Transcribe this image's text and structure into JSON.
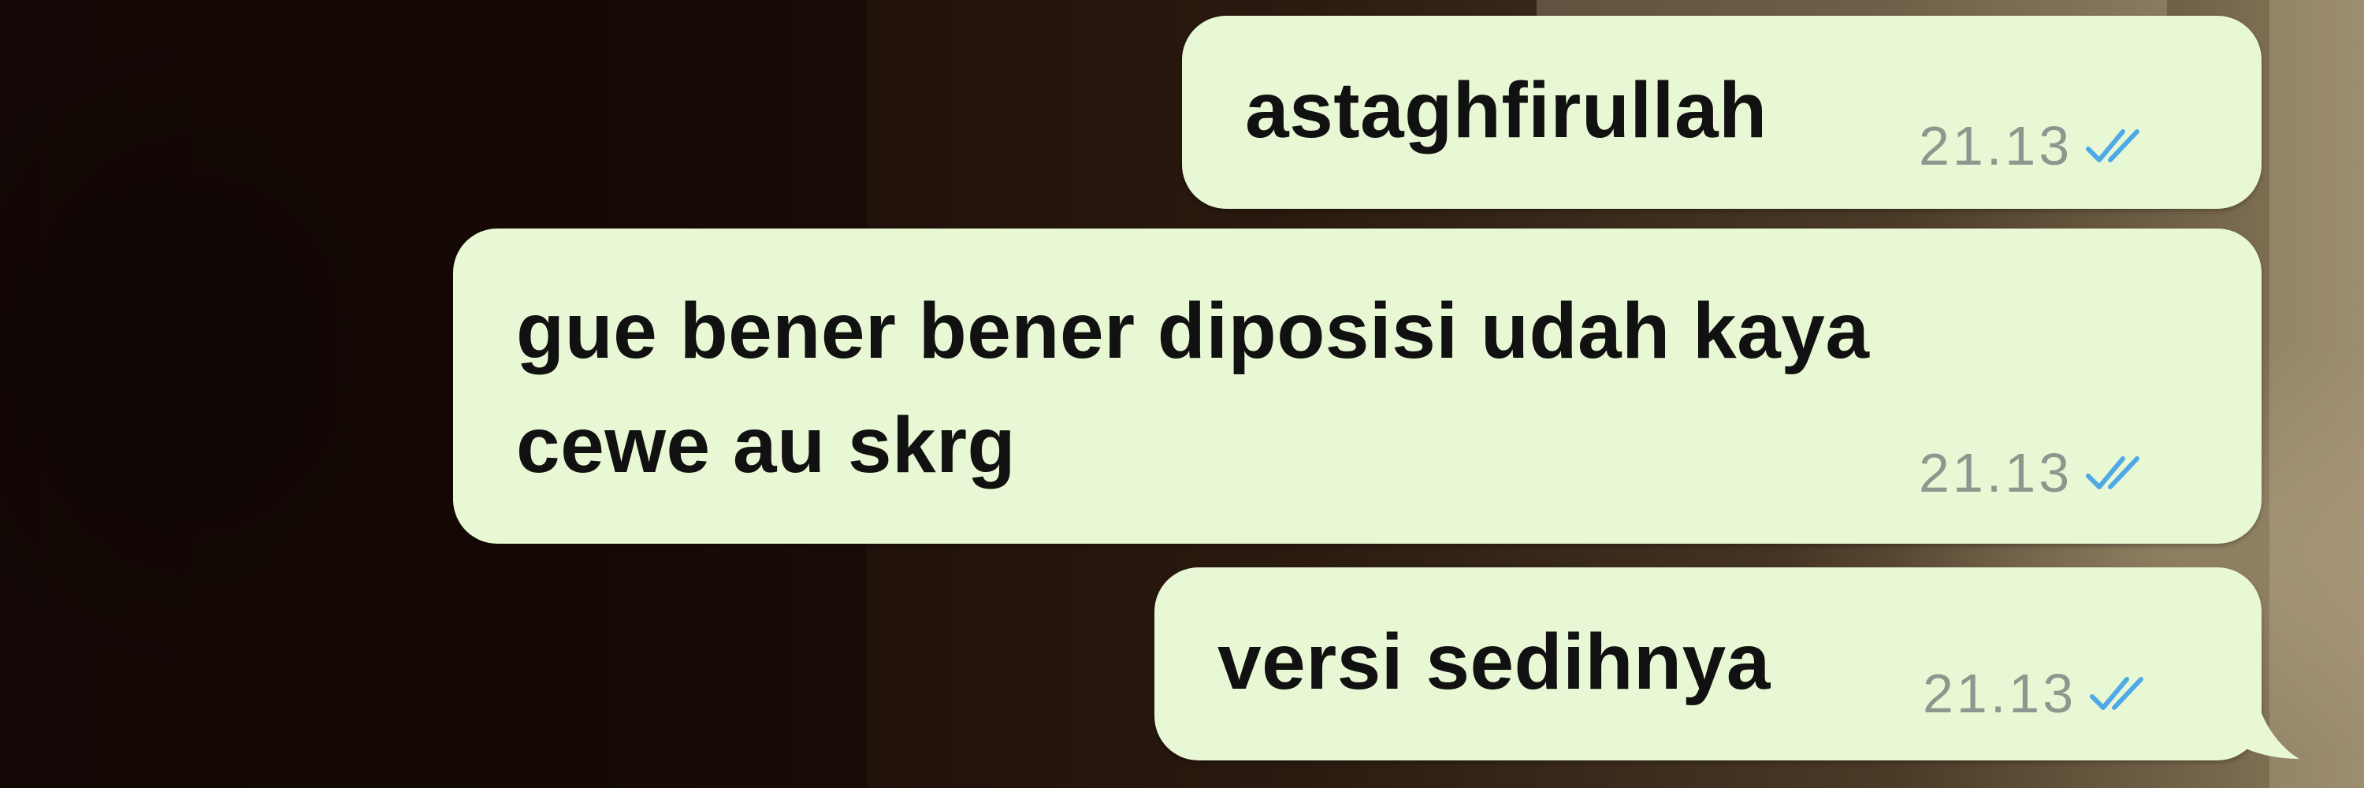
{
  "conversation": {
    "messages": [
      {
        "text": "astaghfirullah",
        "time": "21.13",
        "status": "read",
        "status_icon": "double-check-icon"
      },
      {
        "lines": [
          "gue bener bener diposisi udah kaya",
          "cewe au skrg"
        ],
        "time": "21.13",
        "status": "read",
        "status_icon": "double-check-icon"
      },
      {
        "text": "versi sedihnya",
        "time": "21.13",
        "status": "read",
        "status_icon": "double-check-icon"
      }
    ]
  },
  "colors": {
    "bubble": "#e9f8d4",
    "text": "#111111",
    "time": "#8e978e",
    "read_ticks": "#4fa9e6"
  }
}
